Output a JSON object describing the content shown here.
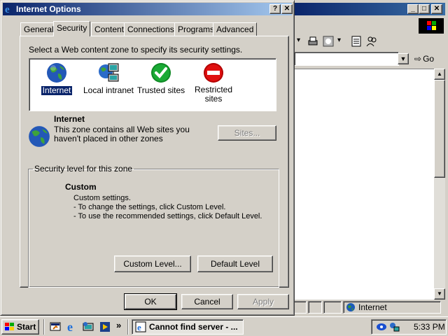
{
  "browser": {
    "menu_glyph": "»",
    "address_go": "Go",
    "status_zone": "Internet"
  },
  "dialog": {
    "title": "Internet Options",
    "help_btn": "?",
    "close_btn": "✕",
    "tabs": [
      {
        "label": "General"
      },
      {
        "label": "Security"
      },
      {
        "label": "Content"
      },
      {
        "label": "Connections"
      },
      {
        "label": "Programs"
      },
      {
        "label": "Advanced"
      }
    ],
    "active_tab": "Security",
    "zone_instruction": "Select a Web content zone to specify its security settings.",
    "zones": [
      {
        "label": "Internet",
        "icon": "globe-icon"
      },
      {
        "label": "Local intranet",
        "icon": "network-computer-icon"
      },
      {
        "label": "Trusted sites",
        "icon": "checkmark-icon"
      },
      {
        "label": "Restricted sites",
        "icon": "restricted-icon"
      }
    ],
    "selected_zone": "Internet",
    "zone_heading": "Internet",
    "zone_description_line1": "This zone contains all Web sites you",
    "zone_description_line2": "haven't placed in other zones",
    "sites_button": "Sites...",
    "security_level_legend": "Security level for this zone",
    "level_name": "Custom",
    "level_lines": [
      "Custom settings.",
      "- To change the settings, click Custom Level.",
      "- To use the recommended settings, click Default Level."
    ],
    "custom_level_button": "Custom Level...",
    "default_level_button": "Default Level",
    "ok_button": "OK",
    "cancel_button": "Cancel",
    "apply_button": "Apply"
  },
  "taskbar": {
    "start_label": "Start",
    "chevron": "»",
    "task_label": "Cannot find server - ...",
    "clock": "5:33 PM"
  },
  "colors": {
    "titlebar_start": "#0a246a",
    "titlebar_end": "#a6caf0",
    "face": "#d4d0c8"
  }
}
